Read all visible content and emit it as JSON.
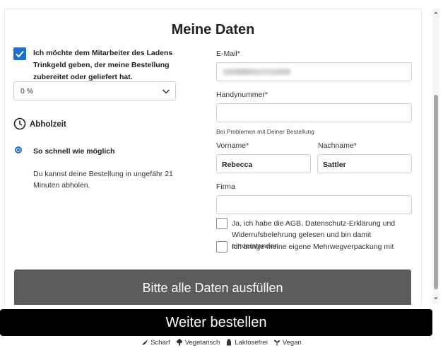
{
  "form": {
    "title": "Meine Daten",
    "tip": {
      "checked": true,
      "label": "Ich möchte dem Mitarbeiter des Ladens Trinkgeld geben, der meine Bestellung zubereitet oder geliefert hat.",
      "selected_value": "0 %"
    },
    "pickup": {
      "heading": "Abholzeit",
      "option_label": "So schnell wie möglich",
      "option_selected": true,
      "info": "Du kannst deine Bestellung in ungefähr 21 Minuten abholen."
    },
    "email": {
      "label": "E-Mail*"
    },
    "phone": {
      "label": "Handynummer*",
      "value": "",
      "hint": "Bei Problemen mit Deiner Bestellung"
    },
    "first_name": {
      "label": "Vorname*",
      "value": "Rebecca"
    },
    "last_name": {
      "label": "Nachname*",
      "value": "Sattler"
    },
    "company": {
      "label": "Firma",
      "value": ""
    },
    "terms": {
      "checked": false,
      "label": "Ja, ich habe die AGB, Datenschutz-Erklärung und Widerrufsbelehrung gelesen und bin damit einverstanden"
    },
    "reusable": {
      "checked": false,
      "label": "Ich bringe meine eigene Mehrwegverpackung mit"
    },
    "submit_label": "Bitte alle Daten ausfüllen"
  },
  "footer": {
    "order_button_label": "Weiter bestellen",
    "legend": [
      {
        "icon": "chili-icon",
        "label": "Scharf"
      },
      {
        "icon": "broccoli-icon",
        "label": "Vegetarisch"
      },
      {
        "icon": "milk-icon",
        "label": "Laktosefrei"
      },
      {
        "icon": "sprout-icon",
        "label": "Vegan"
      }
    ]
  },
  "colors": {
    "accent": "#1f6fd1",
    "submit_disabled": "#5c5c5c",
    "order_bar": "#000000"
  }
}
